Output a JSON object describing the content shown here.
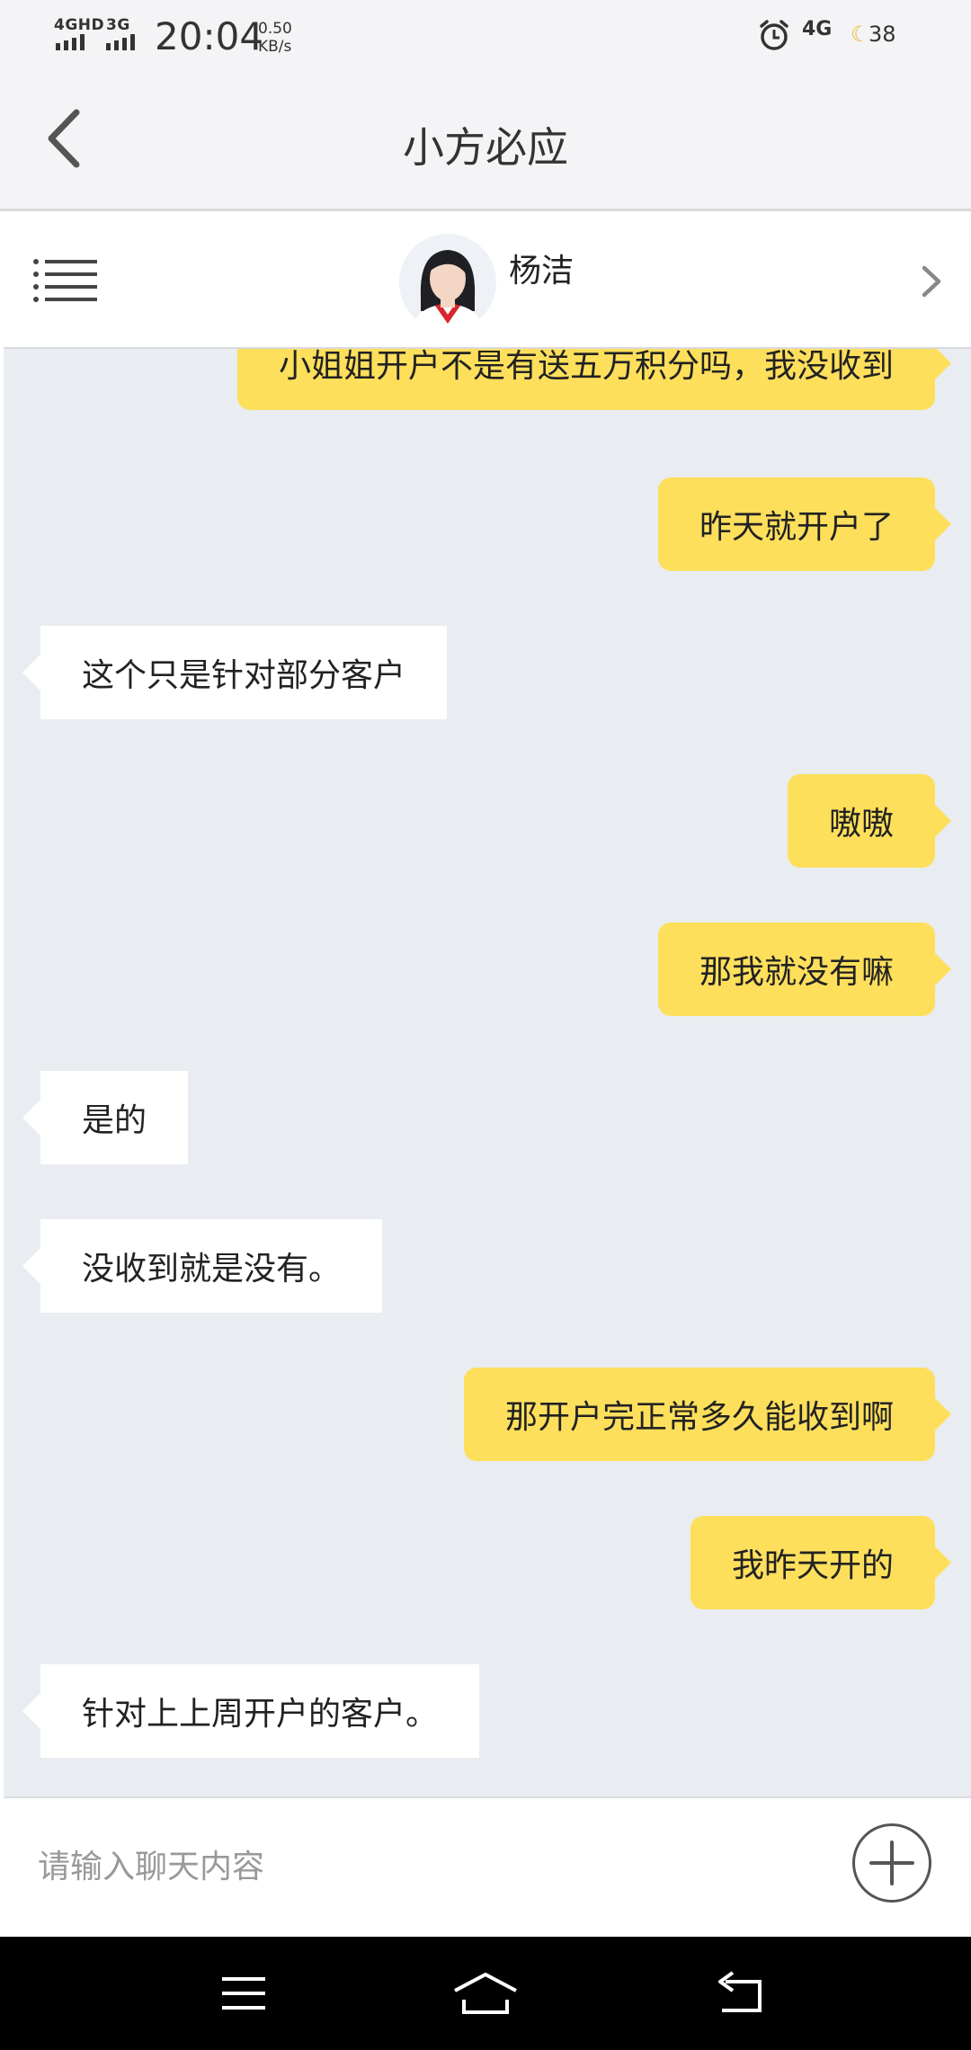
{
  "status_bar": {
    "network_1": "4GHD",
    "network_2": "3G",
    "time": "20:04",
    "speed_value": "0.50",
    "speed_unit": "KB/s",
    "network_3": "4G",
    "battery": "38"
  },
  "header": {
    "title": "小方必应"
  },
  "agent": {
    "name": "杨洁"
  },
  "messages": [
    {
      "side": "me",
      "text": "小姐姐开户不是有送五万积分吗，我没收到"
    },
    {
      "side": "me",
      "text": "昨天就开户了"
    },
    {
      "side": "them",
      "text": "这个只是针对部分客户"
    },
    {
      "side": "me",
      "text": "嗷嗷"
    },
    {
      "side": "me",
      "text": "那我就没有嘛"
    },
    {
      "side": "them",
      "text": "是的"
    },
    {
      "side": "them",
      "text": "没收到就是没有。"
    },
    {
      "side": "me",
      "text": "那开户完正常多久能收到啊"
    },
    {
      "side": "me",
      "text": "我昨天开的"
    },
    {
      "side": "them",
      "text": "针对上上周开户的客户。"
    }
  ],
  "input": {
    "placeholder": "请输入聊天内容",
    "value": ""
  },
  "colors": {
    "my_bubble": "#fddf5c",
    "their_bubble": "#ffffff",
    "chat_background": "#e9ecf0",
    "title_bar": "#f4f4f6"
  },
  "icons": {
    "back": "chevron-left-icon",
    "menu": "menu-lines-icon",
    "agent_detail": "chevron-right-icon",
    "add": "plus-icon",
    "nav_menu": "hamburger-icon",
    "nav_home": "home-icon",
    "nav_back": "back-arrow-icon",
    "alarm": "alarm-clock-icon",
    "night": "moon-icon"
  }
}
